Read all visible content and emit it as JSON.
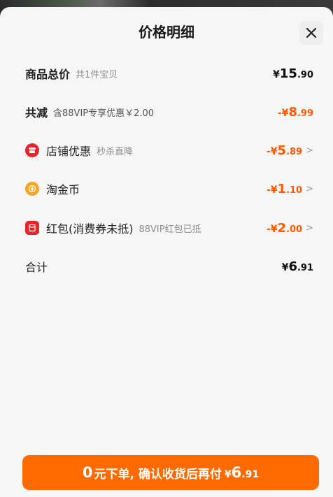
{
  "header": {
    "title": "价格明细"
  },
  "rows": {
    "total_price": {
      "label": "商品总价",
      "sub": "共1件宝贝",
      "sym": "¥",
      "int": "15",
      "dec": ".90"
    },
    "total_discount": {
      "label": "共减",
      "sub": "含88VIP专享优惠￥2.00",
      "sym": "-¥",
      "int": "8",
      "dec": ".99"
    },
    "shop_discount": {
      "label": "店铺优惠",
      "sub": "秒杀直降",
      "sym": "-¥",
      "int": "5",
      "dec": ".89",
      "icon": "shop-icon",
      "icon_color": "#e8242b"
    },
    "taojinbi": {
      "label": "淘金币",
      "sym": "-¥",
      "int": "1",
      "dec": ".10",
      "icon": "coin-icon",
      "icon_color": "#f5a623"
    },
    "red_packet": {
      "label": "红包(消费券未抵)",
      "sub": "88VIP红包已抵",
      "sym": "-¥",
      "int": "2",
      "dec": ".00",
      "icon": "red-packet-icon",
      "icon_color": "#e8242b"
    },
    "subtotal": {
      "label": "合计",
      "sym": "¥",
      "int": "6",
      "dec": ".91"
    }
  },
  "chevron": ">",
  "bottom_button": {
    "zero": "0",
    "text": "元下单, 确认收货后再付",
    "sym": "¥",
    "int": "6",
    "dec": ".91"
  },
  "colors": {
    "accent": "#ff6a00",
    "price_orange": "#ff5a00"
  }
}
